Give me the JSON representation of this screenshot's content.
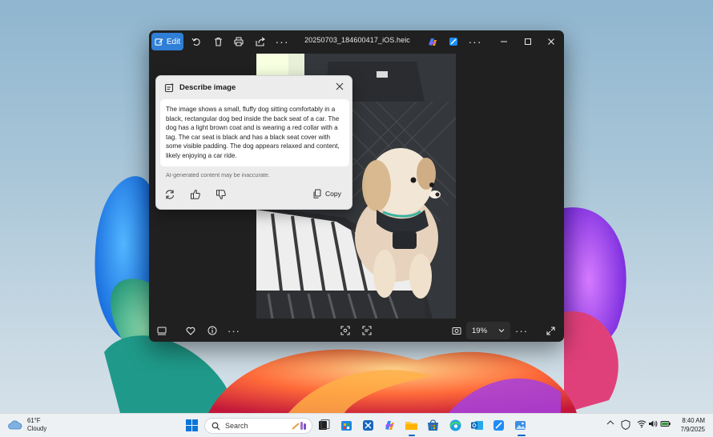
{
  "window": {
    "edit_label": "Edit",
    "file_name": "20250703_184600417_iOS.heic",
    "zoom_level": "19%"
  },
  "describe_panel": {
    "title": "Describe image",
    "description": "The image shows a small, fluffy dog sitting comfortably in a black, rectangular dog bed inside the back seat of a car. The dog has a light brown coat and is wearing a red collar with a tag. The car seat is black and has a black seat cover with some visible padding. The dog appears relaxed and content, likely enjoying a car ride.",
    "disclaimer": "AI-generated content may be inaccurate.",
    "copy_label": "Copy"
  },
  "taskbar": {
    "weather_temp": "61°F",
    "weather_condition": "Cloudy",
    "search_placeholder": "Search",
    "time": "8:40 AM",
    "date": "7/9/2025"
  },
  "colors": {
    "accent": "#2f7fd6",
    "window_bg": "#202020",
    "panel_bg": "#ececec",
    "taskbar_bg": "#eef1f4"
  }
}
